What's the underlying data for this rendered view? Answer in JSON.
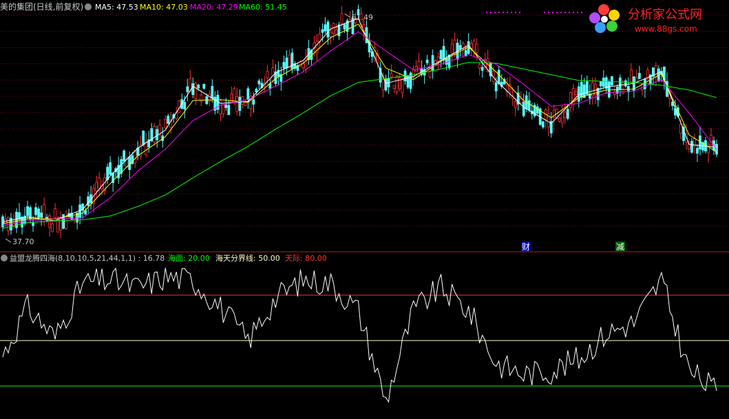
{
  "colors": {
    "bg": "#000000",
    "up": "#ff3232",
    "down": "#54fcfc",
    "ma5": "#ffffff",
    "ma10": "#ffff00",
    "ma20": "#ff00ff",
    "ma60": "#00ff00",
    "grid": "#7a1010",
    "sep": "#b22222",
    "osc": "#ffffff",
    "lineHigh": "#ff3232",
    "lineMid": "#ffffcc",
    "lineLow": "#00ff00",
    "text": "#c8c8c8"
  },
  "header": {
    "title": "美的集团(日线,前复权)",
    "ma5_label": "MA5: 47.53",
    "ma10_label": "MA10: 47.03",
    "ma20_label": "MA20: 47.29",
    "ma60_label": "MA60: 51.45"
  },
  "logo": {
    "text": "分析家公式网",
    "url": "www.88gs.com"
  },
  "main_chart": {
    "max_label": "61.49",
    "min_label": "37.70",
    "event_labels": [
      "财",
      "减"
    ]
  },
  "indicator": {
    "title": "益盟龙腾四海(8,10,10,5,21,44,1,1) : 16.78",
    "sea_label": "海面: 20.00",
    "boundary_label": "海天分界线: 50.00",
    "sky_label": "天际: 80.00"
  },
  "chart_data": [
    {
      "type": "candlestick",
      "title": "美的集团(日线,前复权)",
      "ylim": [
        37.7,
        61.49
      ],
      "x": [
        1,
        10,
        20,
        30,
        40,
        50,
        60,
        70,
        80,
        90,
        100,
        110,
        120,
        130,
        140,
        150,
        160,
        170,
        180,
        190,
        200,
        210,
        220,
        230,
        240,
        250,
        260
      ],
      "series": [
        {
          "name": "MA5",
          "values": [
            39.7,
            40.2,
            39.8,
            41.0,
            44.5,
            47.4,
            49.3,
            53.9,
            52.1,
            52.3,
            55.3,
            56.6,
            59.9,
            61.0,
            54.2,
            54.9,
            56.6,
            58.2,
            54.5,
            51.7,
            50.0,
            53.0,
            53.8,
            54.2,
            55.4,
            47.8,
            47.5
          ]
        },
        {
          "name": "MA10",
          "values": [
            39.5,
            40.0,
            40.0,
            40.6,
            43.7,
            46.6,
            48.6,
            52.4,
            52.5,
            52.2,
            54.7,
            56.3,
            59.0,
            60.4,
            55.8,
            54.6,
            56.5,
            58.0,
            55.4,
            52.4,
            50.6,
            52.7,
            53.5,
            53.6,
            55.2,
            48.8,
            47.0
          ]
        },
        {
          "name": "MA20",
          "values": [
            39.3,
            39.8,
            40.0,
            40.1,
            42.2,
            45.0,
            47.3,
            50.3,
            51.9,
            52.5,
            53.9,
            55.4,
            57.6,
            59.6,
            57.6,
            55.6,
            56.2,
            57.2,
            56.2,
            54.1,
            51.8,
            52.1,
            53.2,
            53.4,
            54.6,
            51.1,
            47.3
          ]
        },
        {
          "name": "MA60",
          "values": [
            39.0,
            39.6,
            39.8,
            39.9,
            40.3,
            41.3,
            42.5,
            44.3,
            46.0,
            47.6,
            49.4,
            51.1,
            52.9,
            54.3,
            54.7,
            55.1,
            55.7,
            56.4,
            56.3,
            55.7,
            55.1,
            54.5,
            54.4,
            54.3,
            54.0,
            53.5,
            52.7
          ]
        }
      ]
    },
    {
      "type": "line",
      "title": "益盟龙腾四海(8,10,10,5,21,44,1,1)",
      "ylim": [
        0,
        100
      ],
      "x": [
        1,
        10,
        20,
        30,
        40,
        50,
        60,
        70,
        80,
        90,
        100,
        110,
        120,
        130,
        140,
        150,
        160,
        170,
        180,
        190,
        200,
        210,
        220,
        230,
        240,
        250,
        260
      ],
      "series": [
        {
          "values": [
            40,
            72,
            52,
            88,
            90,
            85,
            92,
            90,
            72,
            50,
            78,
            90,
            88,
            70,
            10,
            70,
            85,
            70,
            35,
            28,
            30,
            38,
            55,
            62,
            90,
            30,
            16.78
          ]
        }
      ],
      "reference_lines": [
        {
          "name": "海面",
          "value": 20
        },
        {
          "name": "海天分界线",
          "value": 50
        },
        {
          "name": "天际",
          "value": 80
        }
      ]
    }
  ]
}
